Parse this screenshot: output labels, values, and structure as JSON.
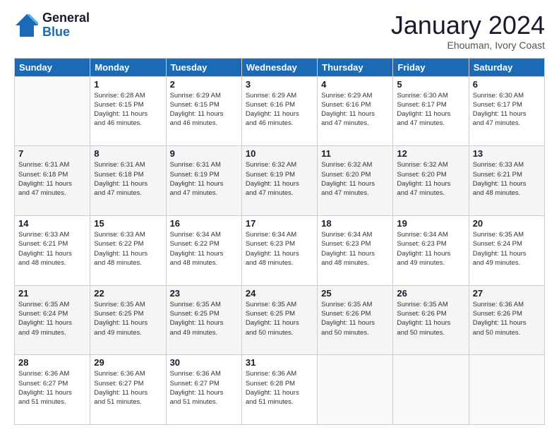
{
  "logo": {
    "general": "General",
    "blue": "Blue"
  },
  "header": {
    "month": "January 2024",
    "location": "Ehouman, Ivory Coast"
  },
  "weekdays": [
    "Sunday",
    "Monday",
    "Tuesday",
    "Wednesday",
    "Thursday",
    "Friday",
    "Saturday"
  ],
  "weeks": [
    [
      {
        "day": "",
        "info": ""
      },
      {
        "day": "1",
        "info": "Sunrise: 6:28 AM\nSunset: 6:15 PM\nDaylight: 11 hours\nand 46 minutes."
      },
      {
        "day": "2",
        "info": "Sunrise: 6:29 AM\nSunset: 6:15 PM\nDaylight: 11 hours\nand 46 minutes."
      },
      {
        "day": "3",
        "info": "Sunrise: 6:29 AM\nSunset: 6:16 PM\nDaylight: 11 hours\nand 46 minutes."
      },
      {
        "day": "4",
        "info": "Sunrise: 6:29 AM\nSunset: 6:16 PM\nDaylight: 11 hours\nand 47 minutes."
      },
      {
        "day": "5",
        "info": "Sunrise: 6:30 AM\nSunset: 6:17 PM\nDaylight: 11 hours\nand 47 minutes."
      },
      {
        "day": "6",
        "info": "Sunrise: 6:30 AM\nSunset: 6:17 PM\nDaylight: 11 hours\nand 47 minutes."
      }
    ],
    [
      {
        "day": "7",
        "info": "Sunrise: 6:31 AM\nSunset: 6:18 PM\nDaylight: 11 hours\nand 47 minutes."
      },
      {
        "day": "8",
        "info": "Sunrise: 6:31 AM\nSunset: 6:18 PM\nDaylight: 11 hours\nand 47 minutes."
      },
      {
        "day": "9",
        "info": "Sunrise: 6:31 AM\nSunset: 6:19 PM\nDaylight: 11 hours\nand 47 minutes."
      },
      {
        "day": "10",
        "info": "Sunrise: 6:32 AM\nSunset: 6:19 PM\nDaylight: 11 hours\nand 47 minutes."
      },
      {
        "day": "11",
        "info": "Sunrise: 6:32 AM\nSunset: 6:20 PM\nDaylight: 11 hours\nand 47 minutes."
      },
      {
        "day": "12",
        "info": "Sunrise: 6:32 AM\nSunset: 6:20 PM\nDaylight: 11 hours\nand 47 minutes."
      },
      {
        "day": "13",
        "info": "Sunrise: 6:33 AM\nSunset: 6:21 PM\nDaylight: 11 hours\nand 48 minutes."
      }
    ],
    [
      {
        "day": "14",
        "info": "Sunrise: 6:33 AM\nSunset: 6:21 PM\nDaylight: 11 hours\nand 48 minutes."
      },
      {
        "day": "15",
        "info": "Sunrise: 6:33 AM\nSunset: 6:22 PM\nDaylight: 11 hours\nand 48 minutes."
      },
      {
        "day": "16",
        "info": "Sunrise: 6:34 AM\nSunset: 6:22 PM\nDaylight: 11 hours\nand 48 minutes."
      },
      {
        "day": "17",
        "info": "Sunrise: 6:34 AM\nSunset: 6:23 PM\nDaylight: 11 hours\nand 48 minutes."
      },
      {
        "day": "18",
        "info": "Sunrise: 6:34 AM\nSunset: 6:23 PM\nDaylight: 11 hours\nand 48 minutes."
      },
      {
        "day": "19",
        "info": "Sunrise: 6:34 AM\nSunset: 6:23 PM\nDaylight: 11 hours\nand 49 minutes."
      },
      {
        "day": "20",
        "info": "Sunrise: 6:35 AM\nSunset: 6:24 PM\nDaylight: 11 hours\nand 49 minutes."
      }
    ],
    [
      {
        "day": "21",
        "info": "Sunrise: 6:35 AM\nSunset: 6:24 PM\nDaylight: 11 hours\nand 49 minutes."
      },
      {
        "day": "22",
        "info": "Sunrise: 6:35 AM\nSunset: 6:25 PM\nDaylight: 11 hours\nand 49 minutes."
      },
      {
        "day": "23",
        "info": "Sunrise: 6:35 AM\nSunset: 6:25 PM\nDaylight: 11 hours\nand 49 minutes."
      },
      {
        "day": "24",
        "info": "Sunrise: 6:35 AM\nSunset: 6:25 PM\nDaylight: 11 hours\nand 50 minutes."
      },
      {
        "day": "25",
        "info": "Sunrise: 6:35 AM\nSunset: 6:26 PM\nDaylight: 11 hours\nand 50 minutes."
      },
      {
        "day": "26",
        "info": "Sunrise: 6:35 AM\nSunset: 6:26 PM\nDaylight: 11 hours\nand 50 minutes."
      },
      {
        "day": "27",
        "info": "Sunrise: 6:36 AM\nSunset: 6:26 PM\nDaylight: 11 hours\nand 50 minutes."
      }
    ],
    [
      {
        "day": "28",
        "info": "Sunrise: 6:36 AM\nSunset: 6:27 PM\nDaylight: 11 hours\nand 51 minutes."
      },
      {
        "day": "29",
        "info": "Sunrise: 6:36 AM\nSunset: 6:27 PM\nDaylight: 11 hours\nand 51 minutes."
      },
      {
        "day": "30",
        "info": "Sunrise: 6:36 AM\nSunset: 6:27 PM\nDaylight: 11 hours\nand 51 minutes."
      },
      {
        "day": "31",
        "info": "Sunrise: 6:36 AM\nSunset: 6:28 PM\nDaylight: 11 hours\nand 51 minutes."
      },
      {
        "day": "",
        "info": ""
      },
      {
        "day": "",
        "info": ""
      },
      {
        "day": "",
        "info": ""
      }
    ]
  ]
}
